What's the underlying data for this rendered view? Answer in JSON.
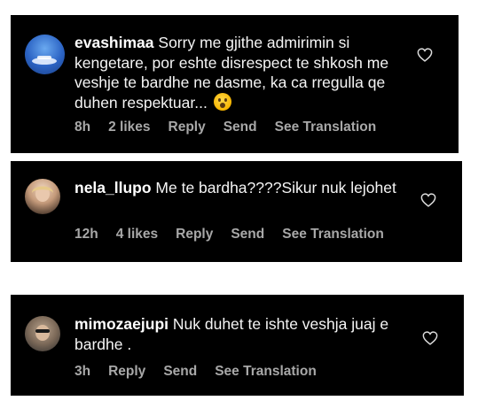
{
  "comments": [
    {
      "username": "evashimaa",
      "text": "Sorry me gjithe admirimin si kengetare, por eshte disrespect te shkosh me veshje te bardhe ne dasme, ka ca rregulla qe duhen respektuar...",
      "emoji": "hushed-face-emoji",
      "time": "8h",
      "likes": "2 likes",
      "reply": "Reply",
      "send": "Send",
      "translate": "See Translation",
      "heart_icon": "heart-outline-icon"
    },
    {
      "username": "nela_llupo",
      "text": "Me te bardha????Sikur nuk lejohet",
      "time": "12h",
      "likes": "4 likes",
      "reply": "Reply",
      "send": "Send",
      "translate": "See Translation",
      "heart_icon": "heart-outline-icon"
    },
    {
      "username": "mimozaejupi",
      "text": "Nuk duhet te ishte veshja juaj e bardhe .",
      "time": "3h",
      "reply": "Reply",
      "send": "Send",
      "translate": "See Translation",
      "heart_icon": "heart-outline-icon"
    }
  ],
  "colors": {
    "card_background": "#000000",
    "text": "#f5f5f5",
    "meta": "#a8a8a8",
    "page_background": "#ffffff"
  }
}
